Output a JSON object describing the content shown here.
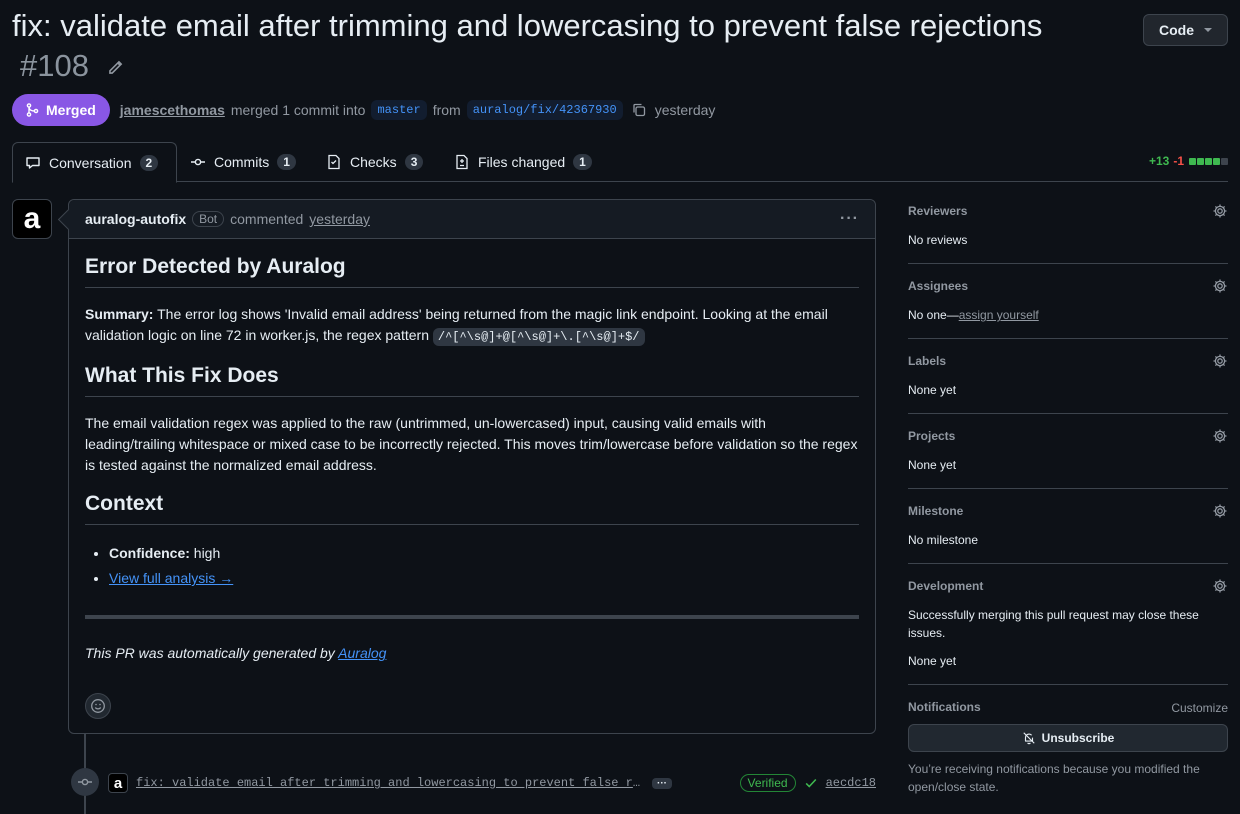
{
  "header": {
    "title": "fix: validate email after trimming and lowercasing to prevent false rejections",
    "number": "#108",
    "code_button": "Code"
  },
  "meta": {
    "state": "Merged",
    "author": "jamescethomas",
    "action": "merged 1 commit into",
    "base_branch": "master",
    "from": "from",
    "head_branch": "auralog/fix/42367930",
    "time": "yesterday"
  },
  "tabs": [
    {
      "label": "Conversation",
      "count": "2",
      "icon": "comment-icon"
    },
    {
      "label": "Commits",
      "count": "1",
      "icon": "commit-icon"
    },
    {
      "label": "Checks",
      "count": "3",
      "icon": "checklist-icon"
    },
    {
      "label": "Files changed",
      "count": "1",
      "icon": "file-diff-icon"
    }
  ],
  "diffstat": {
    "additions": "+13",
    "deletions": "-1"
  },
  "comment": {
    "author": "auralog-autofix",
    "badge": "Bot",
    "verb": "commented",
    "time": "yesterday",
    "h_error": "Error Detected by Auralog",
    "summary_label": "Summary:",
    "summary_text": " The error log shows 'Invalid email address' being returned from the magic link endpoint. Looking at the email validation logic on line 72 in worker.js, the regex pattern ",
    "summary_code": "/^[^\\s@]+@[^\\s@]+\\.[^\\s@]+$/",
    "h_fix": "What This Fix Does",
    "fix_text": "The email validation regex was applied to the raw (untrimmed, un-lowercased) input, causing valid emails with leading/trailing whitespace or mixed case to be incorrectly rejected. This moves trim/lowercase before validation so the regex is tested against the normalized email address.",
    "h_context": "Context",
    "confidence_label": "Confidence:",
    "confidence_value": " high",
    "analysis_link": "View full analysis →",
    "footer_text": "This PR was automatically generated by ",
    "footer_link": "Auralog"
  },
  "commit": {
    "avatar": "a",
    "message": "fix: validate email after trimming and lowercasing to prevent false rejections",
    "verified": "Verified",
    "sha": "aecdc18"
  },
  "avatar_letter": "a",
  "sidebar": {
    "reviewers": {
      "title": "Reviewers",
      "value": "No reviews"
    },
    "assignees": {
      "title": "Assignees",
      "value": "No one—",
      "link": "assign yourself"
    },
    "labels": {
      "title": "Labels",
      "value": "None yet"
    },
    "projects": {
      "title": "Projects",
      "value": "None yet"
    },
    "milestone": {
      "title": "Milestone",
      "value": "No milestone"
    },
    "development": {
      "title": "Development",
      "desc": "Successfully merging this pull request may close these issues.",
      "value": "None yet"
    },
    "notifications": {
      "title": "Notifications",
      "customize": "Customize",
      "button": "Unsubscribe",
      "notice": "You’re receiving notifications because you modified the open/close state."
    }
  },
  "colors": {
    "merged": "#8957e5",
    "add": "#3fb950",
    "del": "#f85149",
    "link": "#4493f8",
    "bg": "#0d1117"
  }
}
